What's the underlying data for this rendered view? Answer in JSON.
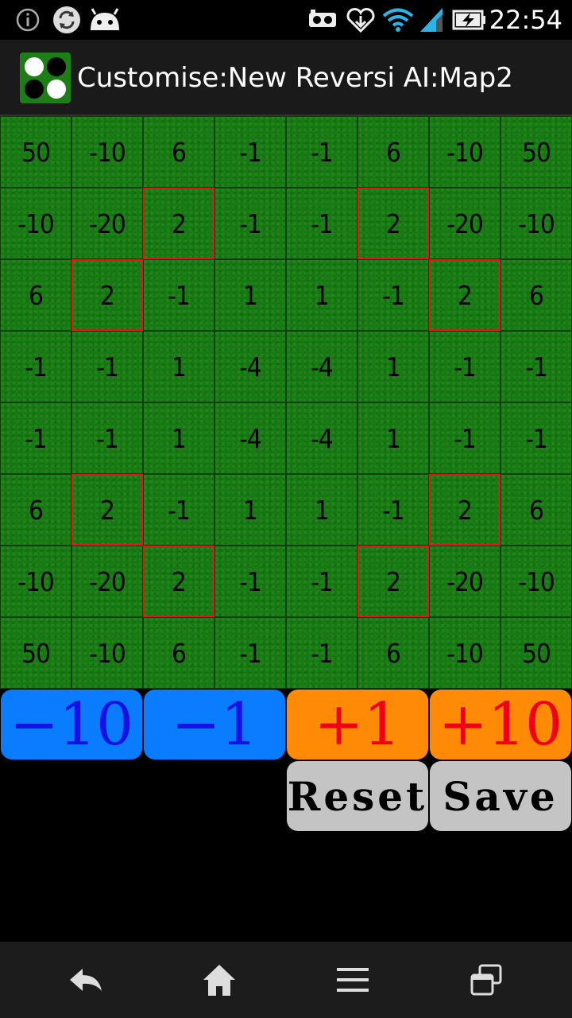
{
  "status_bar": {
    "time": "22:54",
    "icons": [
      "info-icon",
      "sync-icon",
      "android-icon",
      "vr-headset-icon",
      "heart-download-icon",
      "wifi-icon",
      "signal-icon",
      "battery-charging-icon"
    ]
  },
  "title_bar": {
    "app_icon": "reversi-discs-icon",
    "title": "Customise:New Reversi AI:Map2"
  },
  "board": {
    "rows": [
      [
        "50",
        "-10",
        "6",
        "-1",
        "-1",
        "6",
        "-10",
        "50"
      ],
      [
        "-10",
        "-20",
        "2",
        "-1",
        "-1",
        "2",
        "-20",
        "-10"
      ],
      [
        "6",
        "2",
        "-1",
        "1",
        "1",
        "-1",
        "2",
        "6"
      ],
      [
        "-1",
        "-1",
        "1",
        "-4",
        "-4",
        "1",
        "-1",
        "-1"
      ],
      [
        "-1",
        "-1",
        "1",
        "-4",
        "-4",
        "1",
        "-1",
        "-1"
      ],
      [
        "6",
        "2",
        "-1",
        "1",
        "1",
        "-1",
        "2",
        "6"
      ],
      [
        "-10",
        "-20",
        "2",
        "-1",
        "-1",
        "2",
        "-20",
        "-10"
      ],
      [
        "50",
        "-10",
        "6",
        "-1",
        "-1",
        "6",
        "-10",
        "50"
      ]
    ],
    "highlighted_cells": [
      [
        1,
        2
      ],
      [
        1,
        5
      ],
      [
        2,
        1
      ],
      [
        2,
        6
      ],
      [
        5,
        1
      ],
      [
        5,
        6
      ],
      [
        6,
        2
      ],
      [
        6,
        5
      ]
    ],
    "highlight_color": "#e11111",
    "cell_color": "#157a10"
  },
  "controls": {
    "minus10": "−10",
    "minus1": "−1",
    "plus1": "+1",
    "plus10": "+10",
    "reset": "Reset",
    "save": "Save"
  },
  "nav_bar": {
    "icons": [
      "back-icon",
      "home-icon",
      "menu-icon",
      "recent-apps-icon"
    ]
  },
  "colors": {
    "minus_button": "#0a7cff",
    "minus_text": "#1212e6",
    "plus_button": "#ff8a06",
    "plus_text": "#f00010",
    "gray_button": "#c4c4c4"
  }
}
